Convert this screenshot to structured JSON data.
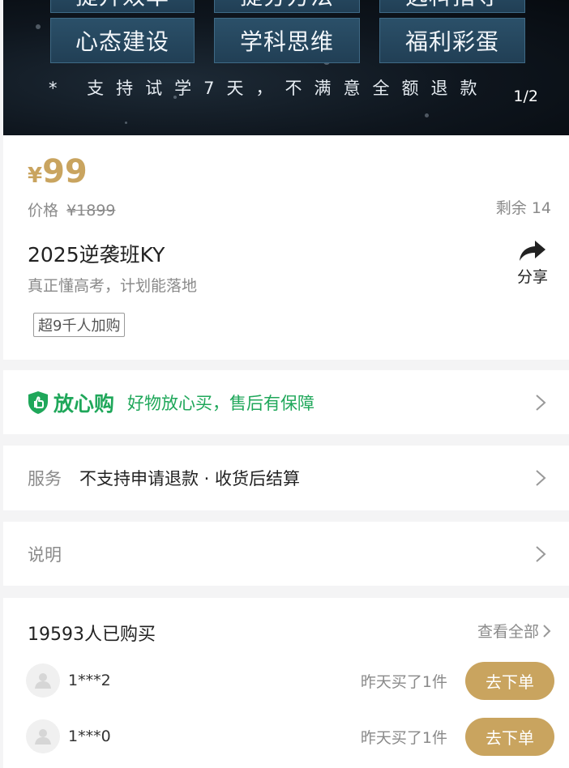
{
  "banner": {
    "top_tags": [
      "提升效率",
      "提分方法",
      "选科指导"
    ],
    "tags": [
      "心态建设",
      "学科思维",
      "福利彩蛋"
    ],
    "tagline": "* 支持试学7天，不满意全额退款",
    "pager": "1/2"
  },
  "product": {
    "currency": "¥",
    "price": "99",
    "orig_label": "价格",
    "orig_price": "¥1899",
    "stock": "剩余 14",
    "title": "2025逆袭班KY",
    "subtitle": "真正懂高考，计划能落地",
    "share_label": "分享",
    "buyers_badge": "超9千人加购"
  },
  "guarantee": {
    "title": "放心购",
    "desc": "好物放心买，售后有保障"
  },
  "service": {
    "label": "服务",
    "value": "不支持申请退款 · 收货后结算"
  },
  "description": {
    "label": "说明"
  },
  "purchases": {
    "count_label": "19593人已购买",
    "view_all": "查看全部",
    "buyers": [
      {
        "name": "1***2",
        "time": "昨天买了1件",
        "button": "去下单"
      },
      {
        "name": "1***0",
        "time": "昨天买了1件",
        "button": "去下单"
      }
    ]
  },
  "colors": {
    "gold": "#c9a45f",
    "green": "#1fa75a"
  }
}
